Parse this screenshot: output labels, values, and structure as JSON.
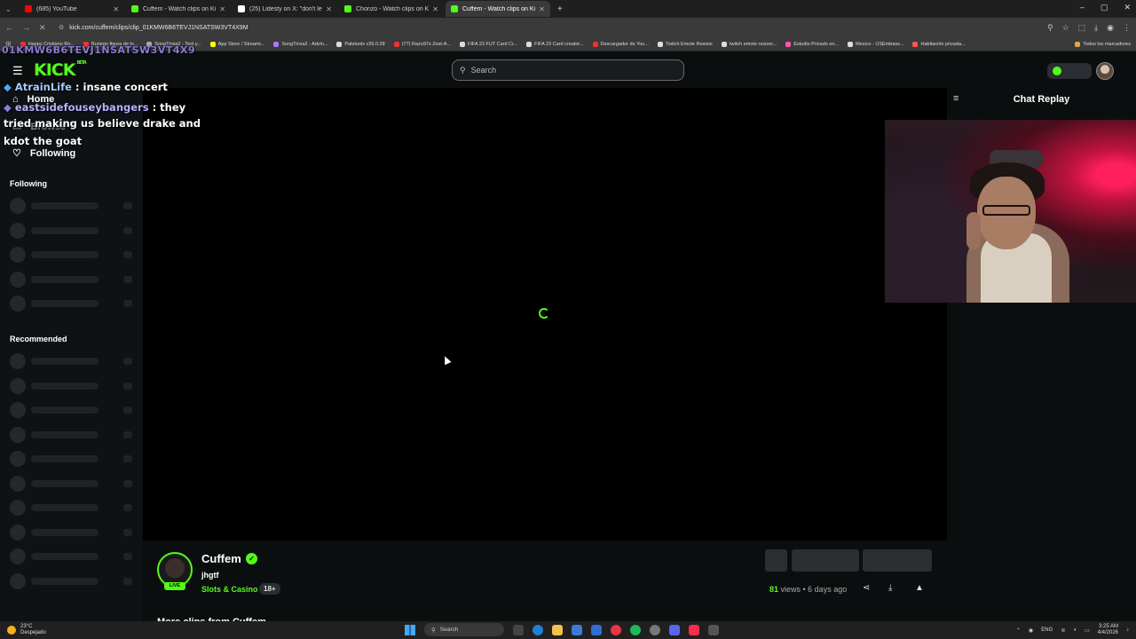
{
  "browser": {
    "tabs": [
      {
        "title": "(685) YouTube",
        "color": "#ff0000",
        "active": false
      },
      {
        "title": "Cuffem - Watch clips on Kick",
        "color": "#53fc18",
        "active": false
      },
      {
        "title": "(25) Lidesty on X: \"don't let any",
        "color": "#ffffff",
        "active": false
      },
      {
        "title": "Chonzo - Watch clips on Kick",
        "color": "#53fc18",
        "active": false
      },
      {
        "title": "Cuffem - Watch clips on Kick",
        "color": "#53fc18",
        "active": true
      }
    ],
    "new_tab_icon": "plus-icon",
    "url": "kick.com/cuffem/clips/clip_01KMW6B6TEVJ1NSATSW3VT4X9M",
    "bookmarks": [
      {
        "label": "Happy Cristiano Ro...",
        "color": "#e33"
      },
      {
        "label": "Buriego figura de lo...",
        "color": "#e33"
      },
      {
        "label": "SongTrivia2 - Test y...",
        "color": "#aaa"
      },
      {
        "label": "App Store / Streami...",
        "color": "#ff0"
      },
      {
        "label": "SongTrivia2 - Advin...",
        "color": "#a7f"
      },
      {
        "label": "Paletools v26.0.28",
        "color": "#ddd"
      },
      {
        "label": "(77) Razo97s Zest-A...",
        "color": "#e33"
      },
      {
        "label": "FIFA 23 FUT Card Cr...",
        "color": "#ddd"
      },
      {
        "label": "FIFA 23 Card creator...",
        "color": "#ddd"
      },
      {
        "label": "Descargador de You...",
        "color": "#e33"
      },
      {
        "label": "Twitch Emote Resizer",
        "color": "#ddd"
      },
      {
        "label": "twitch emote resizer...",
        "color": "#ddd"
      },
      {
        "label": "Estudio Privado en...",
        "color": "#f5a"
      },
      {
        "label": "Mexico - USEmbass...",
        "color": "#ddd"
      },
      {
        "label": "Habitación privada...",
        "color": "#f55"
      }
    ],
    "all_bookmarks": "Todos los marcadores"
  },
  "site": {
    "logo": "KICK",
    "logo_sup": "BETA",
    "search_placeholder": "Search",
    "sidebar": {
      "home": "Home",
      "browse": "Browse",
      "following_link": "Following",
      "following_header": "Following",
      "recommended_header": "Recommended"
    },
    "overlay": {
      "top_text": "01KMW6B6TEVJ1NSATSW3VT4X9",
      "line1_user": "AtrainLife",
      "line1_msg": " : insane concert",
      "line2_user": "eastsidefouseybangers",
      "line2_msg": " : they",
      "line3": "tried making us believe drake and",
      "line4": "kdot the goat"
    },
    "chat": {
      "title": "Chat Replay"
    },
    "channel": {
      "name": "Cuffem",
      "clip_title": "jhgtf",
      "category": "Slots & Casino",
      "age_tag": "18+",
      "live_badge": "LIVE",
      "views_count": "81",
      "views_suffix": " views • 6 days ago",
      "more_clips": "More clips from Cuffem"
    }
  },
  "taskbar": {
    "temp": "23°C",
    "weather": "Despejado",
    "search": "Search",
    "lang": "ENG",
    "time": "3:25 AM",
    "date": "4/4/2026"
  }
}
